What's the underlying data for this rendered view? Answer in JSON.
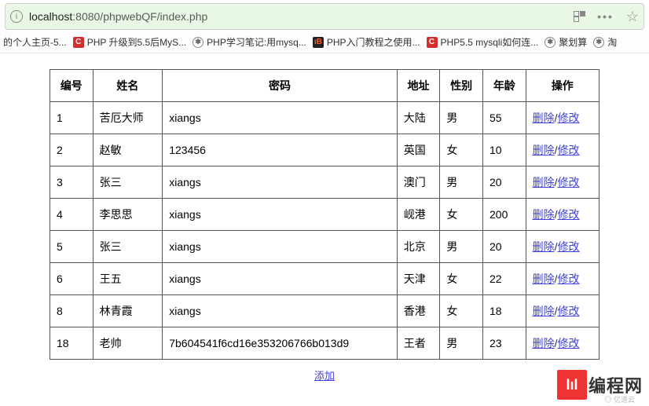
{
  "urlbar": {
    "prefix": "localhost",
    "suffix": ":8080/phpwebQF/index.php",
    "dots": "•••"
  },
  "bookmarks": [
    {
      "icon": "none",
      "label": "的个人主页-5..."
    },
    {
      "icon": "c",
      "label": "PHP 升级到5.5后MyS..."
    },
    {
      "icon": "globe",
      "label": "PHP学习笔记:用mysq..."
    },
    {
      "icon": "i",
      "label": "PHP入门教程之使用..."
    },
    {
      "icon": "c",
      "label": "PHP5.5 mysqli如何连..."
    },
    {
      "icon": "globe",
      "label": "聚划算"
    },
    {
      "icon": "globe",
      "label": "淘"
    }
  ],
  "table": {
    "headers": [
      "编号",
      "姓名",
      "密码",
      "地址",
      "性别",
      "年龄",
      "操作"
    ],
    "rows": [
      {
        "id": "1",
        "name": "苦厄大师",
        "pwd": "xiangs",
        "addr": "大陆",
        "sex": "男",
        "age": "55"
      },
      {
        "id": "2",
        "name": "赵敏",
        "pwd": "123456",
        "addr": "英国",
        "sex": "女",
        "age": "10"
      },
      {
        "id": "3",
        "name": "张三",
        "pwd": "xiangs",
        "addr": "澳门",
        "sex": "男",
        "age": "20"
      },
      {
        "id": "4",
        "name": "李思思",
        "pwd": "xiangs",
        "addr": "岘港",
        "sex": "女",
        "age": "200"
      },
      {
        "id": "5",
        "name": "张三",
        "pwd": "xiangs",
        "addr": "北京",
        "sex": "男",
        "age": "20"
      },
      {
        "id": "6",
        "name": "王五",
        "pwd": "xiangs",
        "addr": "天津",
        "sex": "女",
        "age": "22"
      },
      {
        "id": "8",
        "name": "林青霞",
        "pwd": "xiangs",
        "addr": "香港",
        "sex": "女",
        "age": "18"
      },
      {
        "id": "18",
        "name": "老帅",
        "pwd": "7b604541f6cd16e353206766b013d9",
        "addr": "王者",
        "sex": "男",
        "age": "23"
      }
    ],
    "actions": {
      "delete": "删除",
      "edit": "修改",
      "sep": "/"
    },
    "add": "添加"
  },
  "watermark": {
    "logo": "lıl",
    "text": "编程网",
    "sub": "◎ 亿速云"
  }
}
